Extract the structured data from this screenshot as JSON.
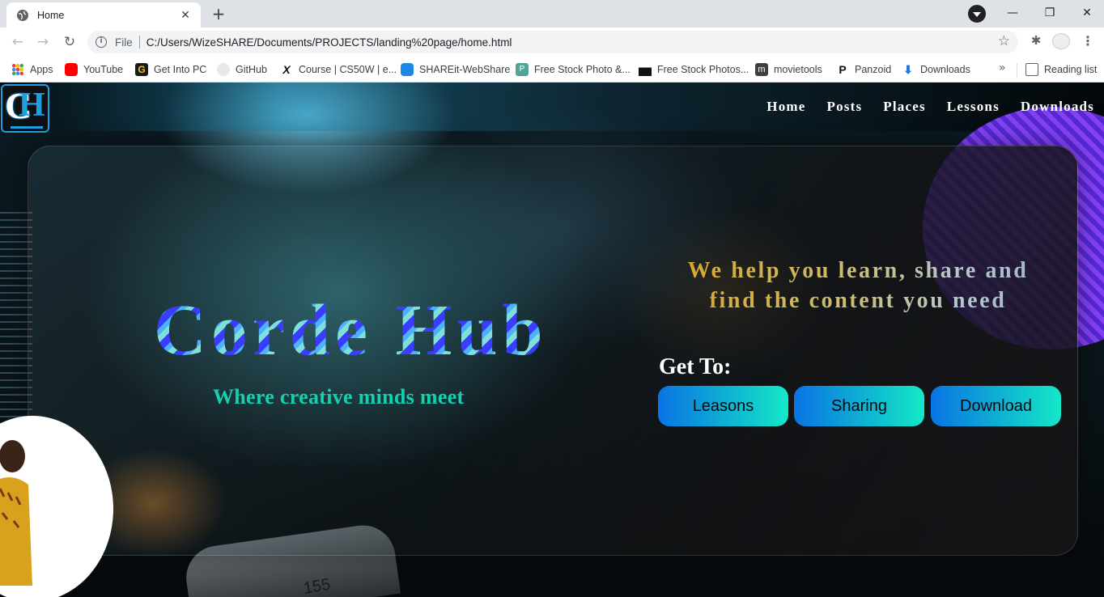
{
  "browser": {
    "tab_title": "Home",
    "tab_close": "✕",
    "new_tab": "+",
    "scheme": "File",
    "url": "C:/Users/WizeSHARE/Documents/PROJECTS/landing%20page/home.html",
    "window_controls": {
      "minimize": "—",
      "restore": "❐",
      "close": "✕"
    },
    "bookmarks": [
      {
        "label": "Apps",
        "icon": "apps-grid-icon"
      },
      {
        "label": "YouTube",
        "icon": "youtube-icon"
      },
      {
        "label": "Get Into PC",
        "icon": "getintopc-icon"
      },
      {
        "label": "GitHub",
        "icon": "github-icon"
      },
      {
        "label": "Course | CS50W | e...",
        "icon": "edx-icon"
      },
      {
        "label": "SHAREit-WebShare",
        "icon": "shareit-icon"
      },
      {
        "label": "Free Stock Photo &...",
        "icon": "pexels-icon"
      },
      {
        "label": "Free Stock Photos...",
        "icon": "unsplash-icon"
      },
      {
        "label": "movietools",
        "icon": "movietools-icon"
      },
      {
        "label": "Panzoid",
        "icon": "panzoid-icon"
      },
      {
        "label": "Downloads",
        "icon": "download-icon"
      }
    ],
    "bookmarks_more": "»",
    "reading_list": "Reading list"
  },
  "site": {
    "nav": [
      "Home",
      "Posts",
      "Places",
      "Lessons",
      "Downloads"
    ],
    "brand": "Corde Hub",
    "tagline": "Where creative minds meet",
    "help_text": "We help you learn, share and find the content you need",
    "get_to_label": "Get To:",
    "buttons": [
      "Leasons",
      "Sharing",
      "Download"
    ],
    "chip_text": "155"
  },
  "colors": {
    "accent": "#1e9fe0",
    "tagline": "#13d1b0",
    "button_gradient_start": "#0a74e4",
    "button_gradient_end": "#14e8c8"
  }
}
